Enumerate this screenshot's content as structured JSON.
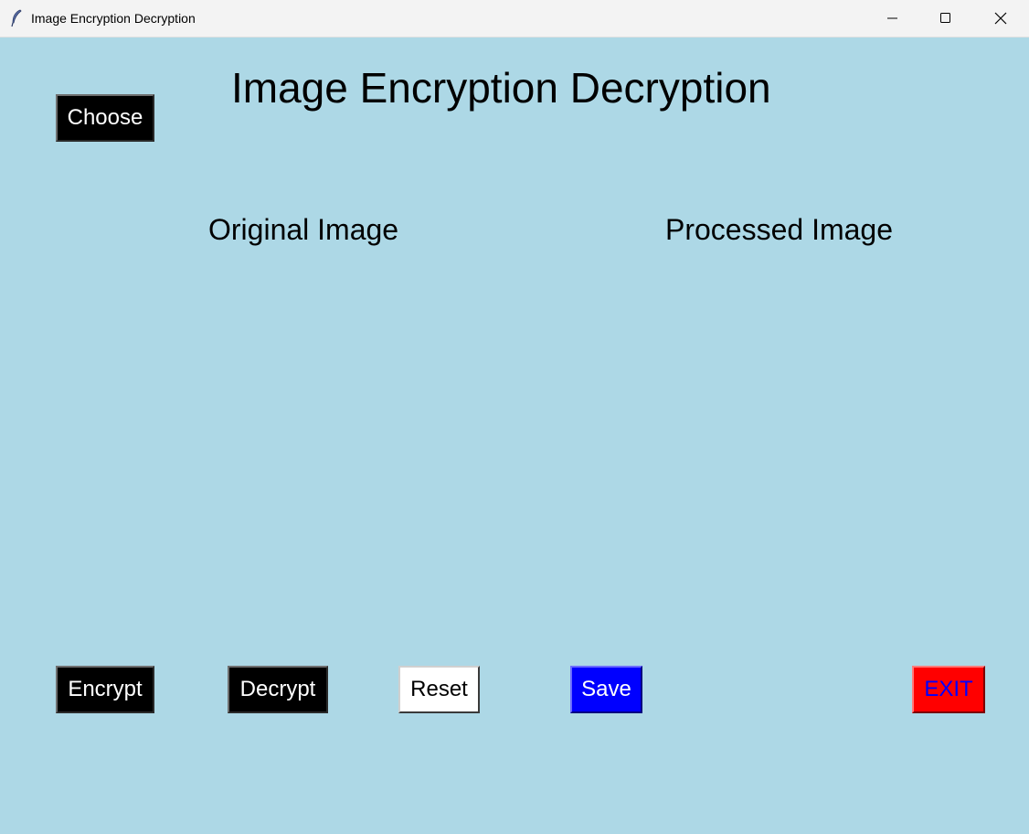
{
  "window": {
    "title": "Image Encryption Decryption",
    "controls": {
      "minimize_icon": "minimize-icon",
      "maximize_icon": "maximize-icon",
      "close_icon": "close-icon"
    }
  },
  "main": {
    "heading": "Image Encryption Decryption",
    "choose_label": "Choose",
    "original_label": "Original Image",
    "processed_label": "Processed Image"
  },
  "actions": {
    "encrypt_label": "Encrypt",
    "decrypt_label": "Decrypt",
    "reset_label": "Reset",
    "save_label": "Save",
    "exit_label": "EXIT"
  },
  "colors": {
    "background": "#add8e6",
    "titlebar": "#f3f3f3",
    "button_black": "#000000",
    "button_white": "#ffffff",
    "button_blue": "#0000ff",
    "button_red": "#ff0000",
    "exit_text": "#0000ff"
  }
}
